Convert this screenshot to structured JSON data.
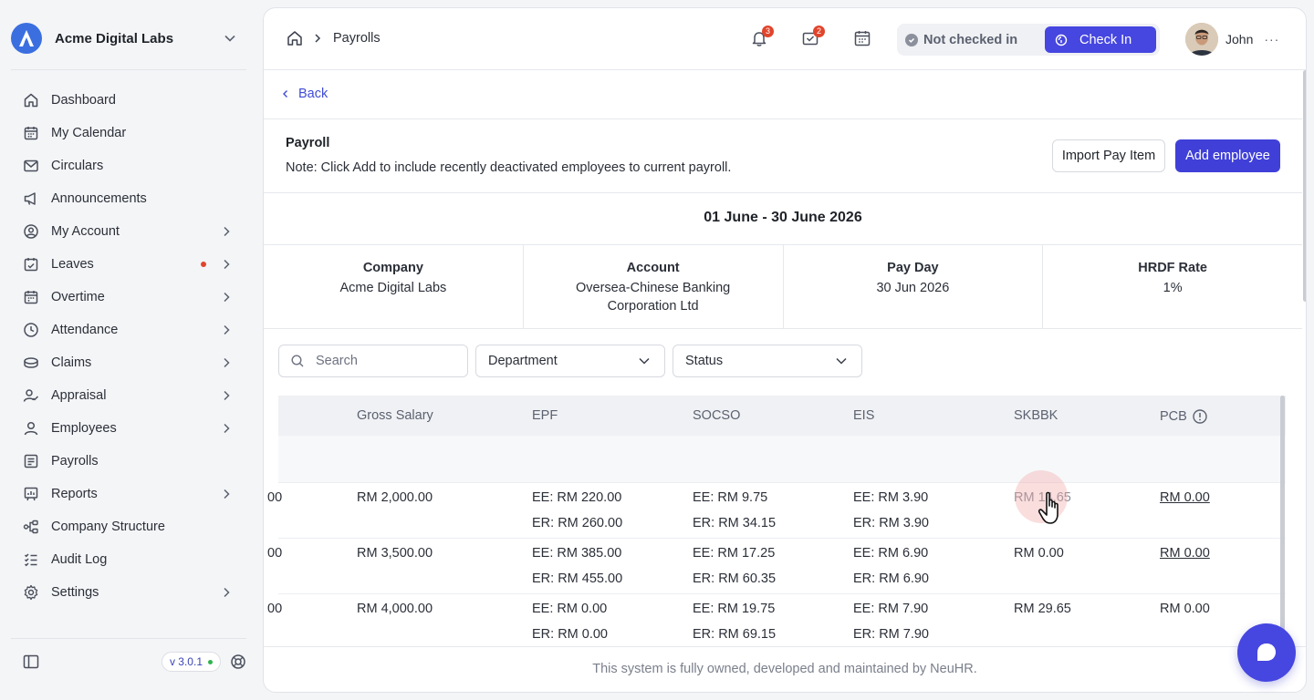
{
  "sidebar": {
    "brand_name": "Acme Digital Labs",
    "items": [
      {
        "label": "Dashboard",
        "icon": "home-icon"
      },
      {
        "label": "My Calendar",
        "icon": "calendar-icon"
      },
      {
        "label": "Circulars",
        "icon": "mail-icon"
      },
      {
        "label": "Announcements",
        "icon": "megaphone-icon"
      },
      {
        "label": "My Account",
        "icon": "user-circle-icon"
      },
      {
        "label": "Leaves",
        "icon": "calendar-check-icon"
      },
      {
        "label": "Overtime",
        "icon": "calendar-clock-icon"
      },
      {
        "label": "Attendance",
        "icon": "clock-icon"
      },
      {
        "label": "Claims",
        "icon": "coins-icon"
      },
      {
        "label": "Appraisal",
        "icon": "user-check-icon"
      },
      {
        "label": "Employees",
        "icon": "user-icon"
      },
      {
        "label": "Payrolls",
        "icon": "payroll-icon"
      },
      {
        "label": "Reports",
        "icon": "report-icon"
      },
      {
        "label": "Company Structure",
        "icon": "structure-icon"
      },
      {
        "label": "Audit Log",
        "icon": "checklist-icon"
      },
      {
        "label": "Settings",
        "icon": "gear-icon"
      }
    ],
    "version": "v 3.0.1"
  },
  "topbar": {
    "breadcrumb": "Payrolls",
    "notifications_count": "3",
    "messages_count": "2",
    "check_status": "Not checked in",
    "checkin_label": "Check In",
    "user_name": "John",
    "more": "···"
  },
  "page": {
    "back_label": "Back",
    "title": "Payroll",
    "note": "Note: Click Add to include recently deactivated employees to current payroll.",
    "import_label": "Import Pay Item",
    "add_label": "Add employee",
    "period": "01 June - 30 June 2026",
    "info": {
      "company_label": "Company",
      "company_value": "Acme Digital Labs",
      "account_label": "Account",
      "account_value": "Oversea-Chinese Banking Corporation Ltd",
      "payday_label": "Pay Day",
      "payday_value": "30 Jun 2026",
      "hrdf_label": "HRDF Rate",
      "hrdf_value": "1%"
    },
    "search_placeholder": "Search",
    "department_label": "Department",
    "status_label": "Status"
  },
  "table": {
    "headers": [
      "Gross Salary",
      "EPF",
      "SOCSO",
      "EIS",
      "SKBBK",
      "PCB"
    ],
    "rows": [
      {
        "prev": "00",
        "gross": "RM 2,000.00",
        "epf_ee": "EE: RM 220.00",
        "epf_er": "ER: RM 260.00",
        "socso_ee": "EE: RM 9.75",
        "socso_er": "ER: RM 34.15",
        "eis_ee": "EE: RM 3.90",
        "eis_er": "ER: RM 3.90",
        "skbbk": "RM 14.65",
        "pcb": "RM 0.00"
      },
      {
        "prev": "00",
        "gross": "RM 3,500.00",
        "epf_ee": "EE: RM 385.00",
        "epf_er": "ER: RM 455.00",
        "socso_ee": "EE: RM 17.25",
        "socso_er": "ER: RM 60.35",
        "eis_ee": "EE: RM 6.90",
        "eis_er": "ER: RM 6.90",
        "skbbk": "RM 0.00",
        "pcb": "RM 0.00"
      },
      {
        "prev": "00",
        "gross": "RM 4,000.00",
        "epf_ee": "EE: RM 0.00",
        "epf_er": "ER: RM 0.00",
        "socso_ee": "EE: RM 19.75",
        "socso_er": "ER: RM 69.15",
        "eis_ee": "EE: RM 7.90",
        "eis_er": "ER: RM 7.90",
        "skbbk": "RM 29.65",
        "pcb": "RM 0.00"
      }
    ]
  },
  "footer": "This system is fully owned, developed and maintained by NeuHR.",
  "colors": {
    "accent": "#4646e0",
    "badge": "#e0452b",
    "brand_logo": "#3b6fe0"
  }
}
